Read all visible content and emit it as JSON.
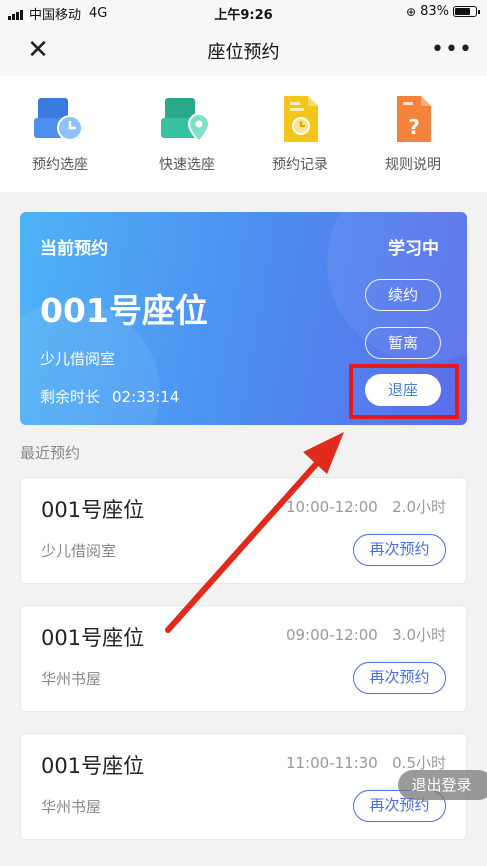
{
  "status_bar": {
    "carrier": "中国移动",
    "network": "4G",
    "time": "上午9:26",
    "battery": "83%",
    "battery_level": 0.83
  },
  "nav": {
    "title": "座位预约",
    "close_icon": "close-icon",
    "more_icon": "more-icon",
    "more_label": "•••"
  },
  "menu": [
    {
      "label": "预约选座",
      "icon": "clock-seat-icon"
    },
    {
      "label": "快速选座",
      "icon": "location-seat-icon"
    },
    {
      "label": "预约记录",
      "icon": "record-icon"
    },
    {
      "label": "规则说明",
      "icon": "rules-question-icon"
    }
  ],
  "current": {
    "label": "当前预约",
    "status": "学习中",
    "seat": "001号座位",
    "room": "少儿借阅室",
    "remaining_label": "剩余时长",
    "remaining_value": "02:33:14",
    "buttons": {
      "renew": "续约",
      "leave": "暂离",
      "checkout": "退座"
    }
  },
  "recent": {
    "title": "最近预约",
    "items": [
      {
        "seat": "001号座位",
        "time": "10:00-12:00   2.0小时",
        "room": "少儿借阅室",
        "button": "再次预约"
      },
      {
        "seat": "001号座位",
        "time": "09:00-12:00   3.0小时",
        "room": "华州书屋",
        "button": "再次预约"
      },
      {
        "seat": "001号座位",
        "time": "11:00-11:30   0.5小时",
        "room": "华州书屋",
        "button": "再次预约"
      }
    ]
  },
  "logout": "退出登录",
  "colors": {
    "card_start": "#4eb3f6",
    "card_end": "#5a6eea",
    "accent": "#4a6ee0",
    "highlight": "#e11b1b",
    "arrow": "#e02a1c"
  }
}
